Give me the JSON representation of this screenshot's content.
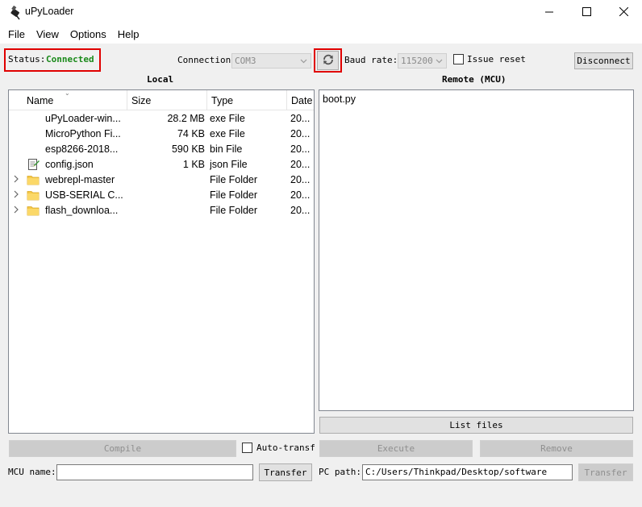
{
  "window": {
    "title": "uPyLoader"
  },
  "menu": [
    "File",
    "View",
    "Options",
    "Help"
  ],
  "toolbar": {
    "status_label": "Status:",
    "status_value": "Connected",
    "status_color": "#1a8a1a",
    "connection_label": "Connection",
    "connection_value": "COM3",
    "baud_label": "Baud rate:",
    "baud_value": "115200",
    "issue_reset_label": "Issue reset",
    "issue_reset_checked": false,
    "disconnect_label": "Disconnect"
  },
  "local": {
    "title": "Local",
    "columns": [
      "Name",
      "Size",
      "Type",
      "Date"
    ],
    "rows": [
      {
        "name": "uPyLoader-win...",
        "size": "28.2 MB",
        "type": "exe File",
        "date": "20...",
        "icon": "exe-file-icon",
        "expandable": false
      },
      {
        "name": "MicroPython Fi...",
        "size": "74 KB",
        "type": "exe File",
        "date": "20...",
        "icon": "exe-file-icon",
        "expandable": false
      },
      {
        "name": "esp8266-2018...",
        "size": "590 KB",
        "type": "bin File",
        "date": "20...",
        "icon": "bin-file-icon",
        "expandable": false
      },
      {
        "name": "config.json",
        "size": "1 KB",
        "type": "json File",
        "date": "20...",
        "icon": "json-file-icon",
        "expandable": false
      },
      {
        "name": "webrepl-master",
        "size": "",
        "type": "File Folder",
        "date": "20...",
        "icon": "folder-icon",
        "expandable": true
      },
      {
        "name": "USB-SERIAL C...",
        "size": "",
        "type": "File Folder",
        "date": "20...",
        "icon": "folder-icon",
        "expandable": true
      },
      {
        "name": "flash_downloa...",
        "size": "",
        "type": "File Folder",
        "date": "20...",
        "icon": "folder-icon",
        "expandable": true
      }
    ]
  },
  "remote": {
    "title": "Remote (MCU)",
    "files": [
      "boot.py"
    ],
    "list_files_label": "List files"
  },
  "actions": {
    "compile_label": "Compile",
    "auto_transfer_label": "Auto-transfer",
    "auto_transfer_checked": false,
    "execute_label": "Execute",
    "remove_label": "Remove"
  },
  "bottom": {
    "mcu_name_label": "MCU name:",
    "mcu_name_value": "",
    "transfer_label": "Transfer",
    "pc_path_label": "PC path:",
    "pc_path_value": "C:/Users/Thinkpad/Desktop/software",
    "transfer2_label": "Transfer"
  },
  "icons": {
    "minimize": "minimize-icon",
    "maximize": "maximize-icon",
    "close": "close-icon",
    "refresh": "refresh-icon"
  }
}
